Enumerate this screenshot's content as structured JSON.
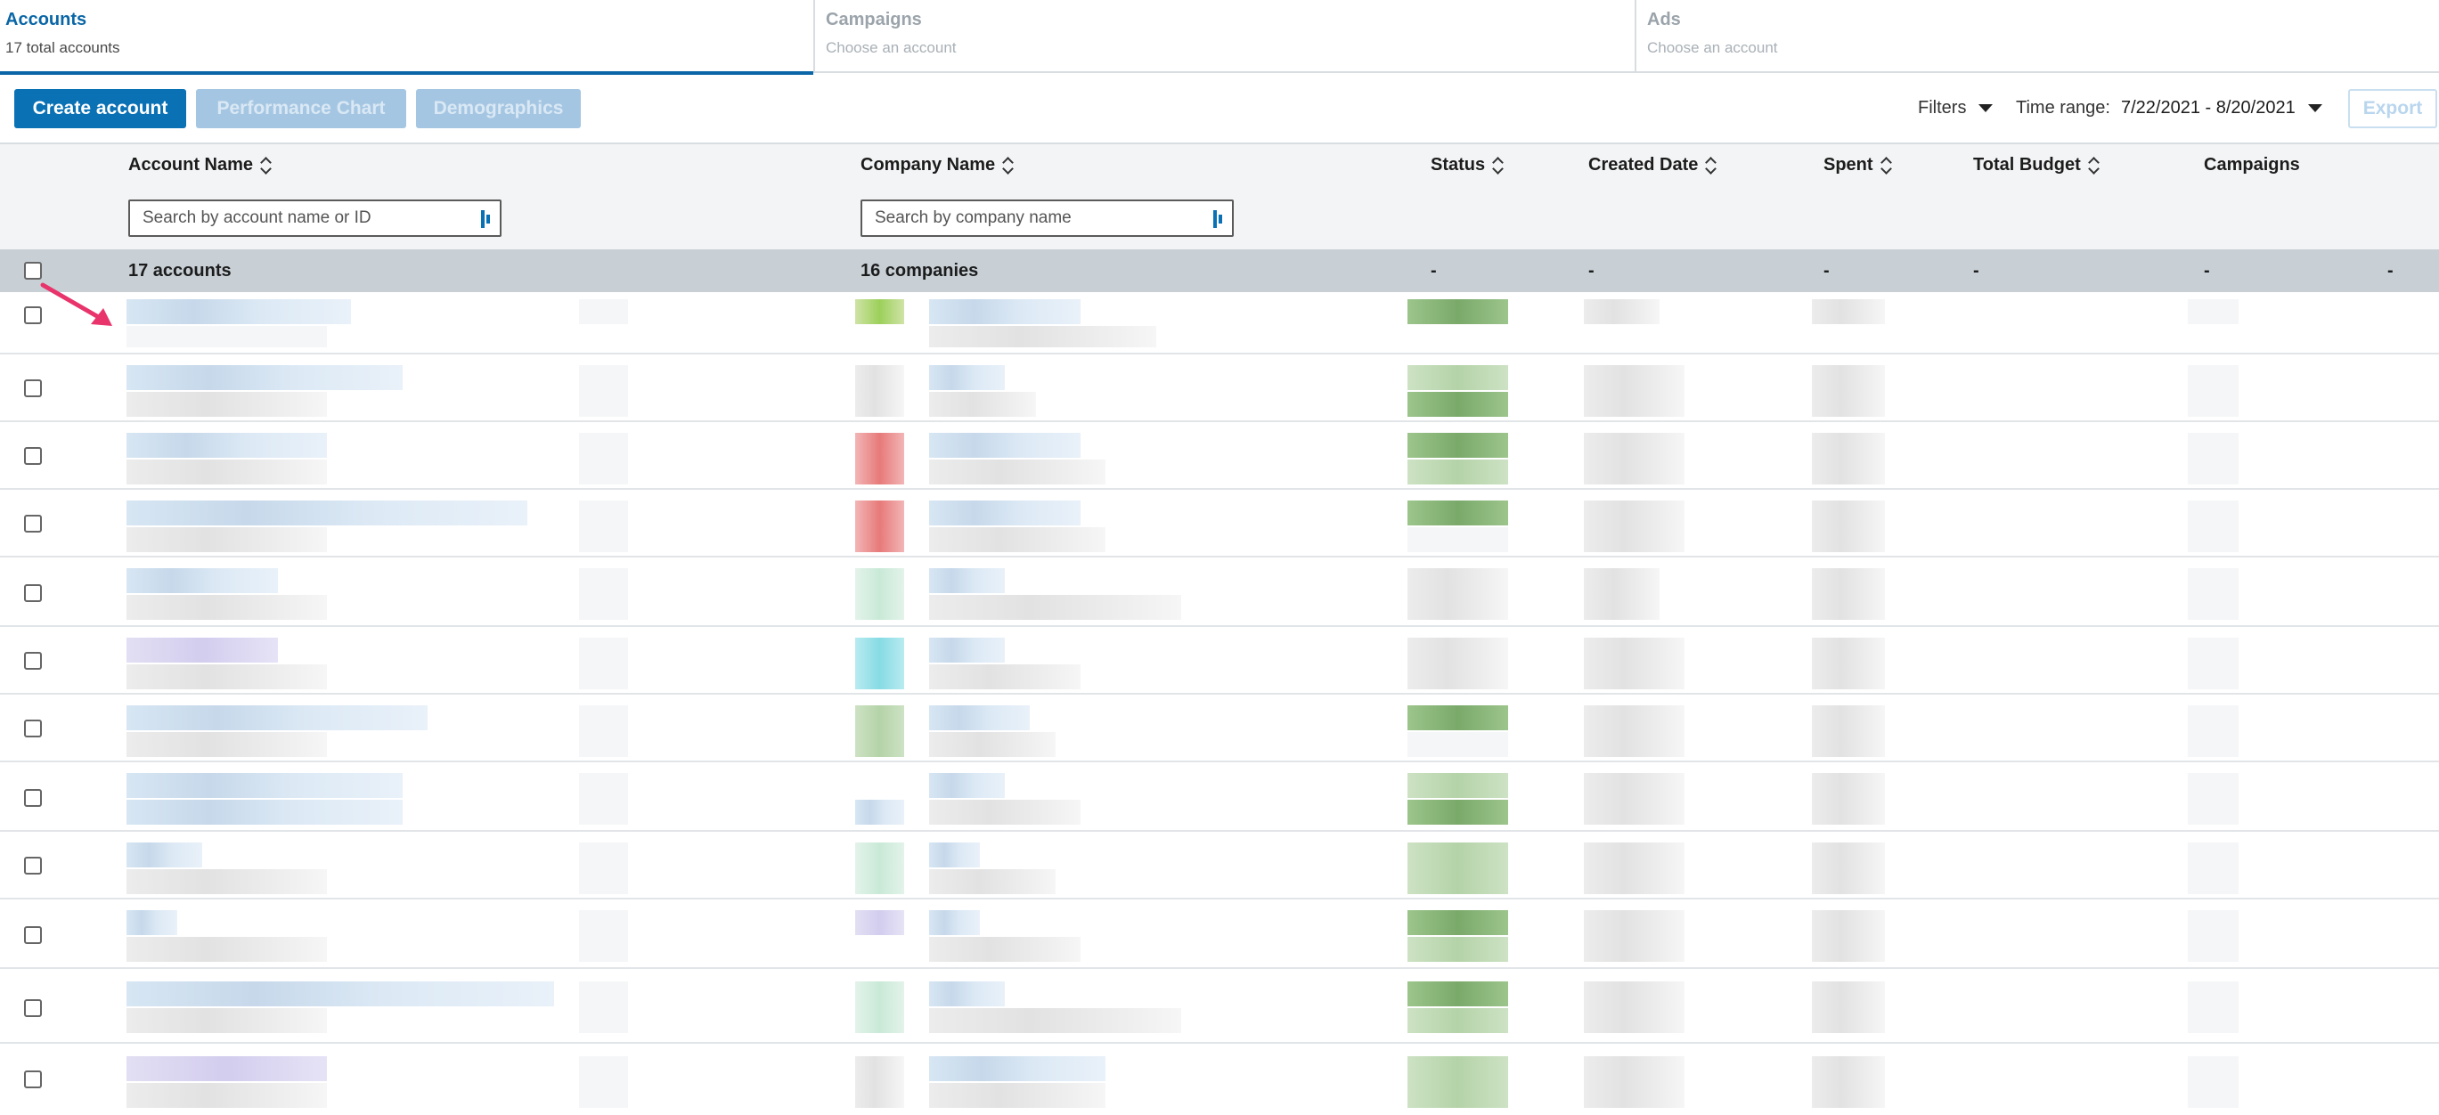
{
  "tabs": [
    {
      "title": "Accounts",
      "subtitle": "17 total accounts",
      "active": true
    },
    {
      "title": "Campaigns",
      "subtitle": "Choose an account",
      "active": false
    },
    {
      "title": "Ads",
      "subtitle": "Choose an account",
      "active": false
    }
  ],
  "toolbar": {
    "create_label": "Create account",
    "performance_label": "Performance Chart",
    "demographics_label": "Demographics",
    "filters_label": "Filters",
    "time_range_label": "Time range:",
    "time_range_value": "7/22/2021 - 8/20/2021",
    "export_label": "Export"
  },
  "table": {
    "columns": {
      "account_name": "Account Name",
      "company_name": "Company Name",
      "status": "Status",
      "created_date": "Created Date",
      "spent": "Spent",
      "total_budget": "Total Budget",
      "campaigns": "Campaigns"
    },
    "search_account_placeholder": "Search by account name or ID",
    "search_company_placeholder": "Search by company name",
    "summary": {
      "accounts": "17 accounts",
      "companies": "16 companies",
      "status": "-",
      "created_date": "-",
      "spent": "-",
      "total_budget": "-",
      "campaigns": "-",
      "extra": "-"
    }
  },
  "colors": {
    "accent": "#0a71b5",
    "active_tab": "#0a66a6",
    "annotation_arrow": "#e8336b"
  }
}
